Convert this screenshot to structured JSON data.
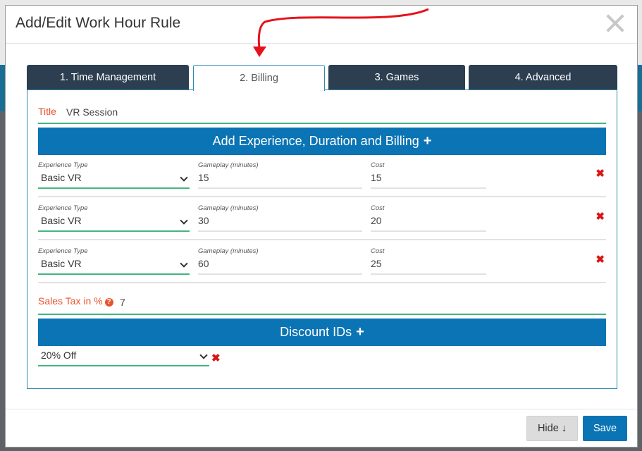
{
  "modal": {
    "title": "Add/Edit Work Hour Rule"
  },
  "tabs": [
    {
      "label": "1. Time Management",
      "active": false
    },
    {
      "label": "2. Billing",
      "active": true
    },
    {
      "label": "3. Games",
      "active": false
    },
    {
      "label": "4. Advanced",
      "active": false
    }
  ],
  "title_field": {
    "label": "Title",
    "value": "VR Session"
  },
  "experience_section": {
    "label": "Add Experience, Duration and Billing",
    "icon": "plus-icon"
  },
  "experience_rows": [
    {
      "type_label": "Experience Type",
      "type_value": "Basic VR",
      "gameplay_label": "Gameplay (minutes)",
      "gameplay_value": "15",
      "cost_label": "Cost",
      "cost_value": "15"
    },
    {
      "type_label": "Experience Type",
      "type_value": "Basic VR",
      "gameplay_label": "Gameplay (minutes)",
      "gameplay_value": "30",
      "cost_label": "Cost",
      "cost_value": "20"
    },
    {
      "type_label": "Experience Type",
      "type_value": "Basic VR",
      "gameplay_label": "Gameplay (minutes)",
      "gameplay_value": "60",
      "cost_label": "Cost",
      "cost_value": "25"
    }
  ],
  "sales_tax": {
    "label": "Sales Tax in %",
    "value": "7",
    "help_icon": "question-circle-icon"
  },
  "discount_section": {
    "label": "Discount IDs",
    "icon": "plus-icon"
  },
  "discount_select": {
    "value": "20% Off"
  },
  "footer": {
    "hide_label": "Hide ↓",
    "save_label": "Save"
  },
  "colors": {
    "accent": "#0a74b4",
    "tab_dark": "#2c3e50",
    "valid": "#43b581",
    "label": "#e8542e",
    "delete": "#d91515",
    "annotation_arrow": "#e5121b"
  }
}
